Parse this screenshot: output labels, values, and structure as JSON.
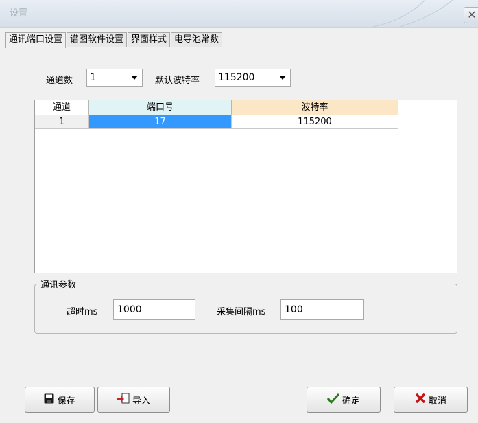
{
  "window": {
    "title": "设置",
    "close_glyph": "✕"
  },
  "tabs": [
    {
      "label": "通讯端口设置",
      "active": true
    },
    {
      "label": "谱图软件设置",
      "active": false
    },
    {
      "label": "界面样式",
      "active": false
    },
    {
      "label": "电导池常数",
      "active": false
    }
  ],
  "channel_count": {
    "label": "通道数",
    "value": "1"
  },
  "default_baud": {
    "label": "默认波特率",
    "value": "115200"
  },
  "grid": {
    "headers": [
      "通道",
      "端口号",
      "波特率"
    ],
    "header_colors": [
      "#f0f0f0",
      "#e0f4f6",
      "#fbe7c6"
    ],
    "selected_color": "#3399ff",
    "rows": [
      {
        "channel": "1",
        "port": "17",
        "baud": "115200"
      }
    ]
  },
  "comm_params": {
    "title": "通讯参数",
    "timeout_label": "超时ms",
    "timeout_value": "1000",
    "interval_label": "采集间隔ms",
    "interval_value": "100"
  },
  "buttons": {
    "save": "保存",
    "import": "导入",
    "confirm": "确定",
    "cancel": "取消"
  },
  "icons": {
    "save": "floppy-disk-icon",
    "import": "import-document-icon",
    "confirm": "check-mark-icon",
    "cancel": "cross-icon"
  },
  "colors": {
    "confirm_icon": "#2a7a1e",
    "cancel_icon": "#cc1111",
    "import_icon": "#cc2222"
  }
}
